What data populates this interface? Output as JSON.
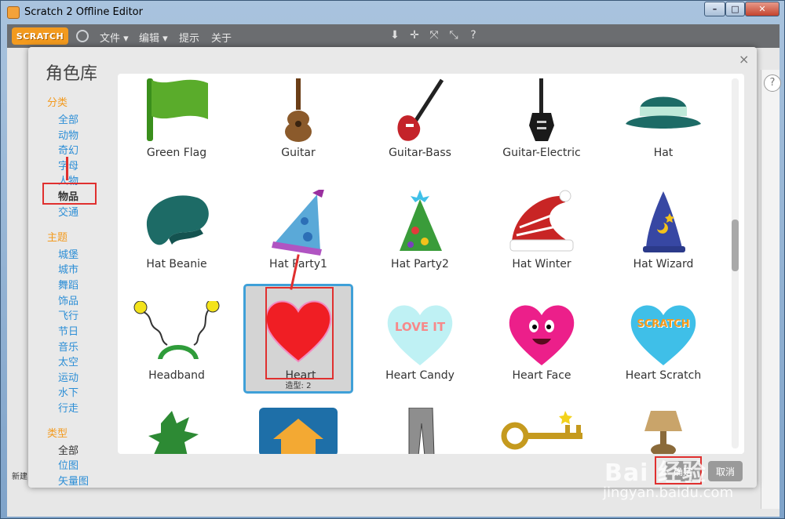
{
  "window": {
    "title": "Scratch 2 Offline Editor",
    "controls": [
      "–",
      "□",
      "✕"
    ]
  },
  "menubar": {
    "logo": "SCRATCH",
    "items": [
      "文件 ▾",
      "编辑 ▾",
      "提示",
      "关于"
    ]
  },
  "dialog": {
    "title": "角色库",
    "close": "×",
    "categories_heading": "分类",
    "categories": [
      "全部",
      "动物",
      "奇幻",
      "字母",
      "人物",
      "物品",
      "交通"
    ],
    "selected_category": "物品",
    "themes_heading": "主题",
    "themes": [
      "城堡",
      "城市",
      "舞蹈",
      "饰品",
      "飞行",
      "节日",
      "音乐",
      "太空",
      "运动",
      "水下",
      "行走"
    ],
    "types_heading": "类型",
    "types": [
      "全部",
      "位图",
      "矢量图"
    ],
    "selected_type": "全部",
    "ok_label": "确定",
    "cancel_label": "取消"
  },
  "sprites": {
    "row1": [
      "Green Flag",
      "Guitar",
      "Guitar-Bass",
      "Guitar-Electric",
      "Hat"
    ],
    "row2": [
      "Hat Beanie",
      "Hat Party1",
      "Hat Party2",
      "Hat Winter",
      "Hat Wizard"
    ],
    "row3": [
      "Headband",
      "Heart",
      "Heart Candy",
      "Heart Face",
      "Heart Scratch"
    ],
    "selected": "Heart",
    "selected_costumes": "造型: 2",
    "heart_candy_text": "LOVE IT",
    "heart_scratch_text": "SCRATCH"
  },
  "editor_behind": {
    "new_sprite": "新建",
    "help": "?"
  },
  "watermark": {
    "brand": "Bai 经验",
    "url": "jingyan.baidu.com"
  },
  "colors": {
    "accent": "#f39a1e",
    "link": "#2c8ed6",
    "highlight": "#e0302f",
    "selection": "#3fa0d8"
  }
}
